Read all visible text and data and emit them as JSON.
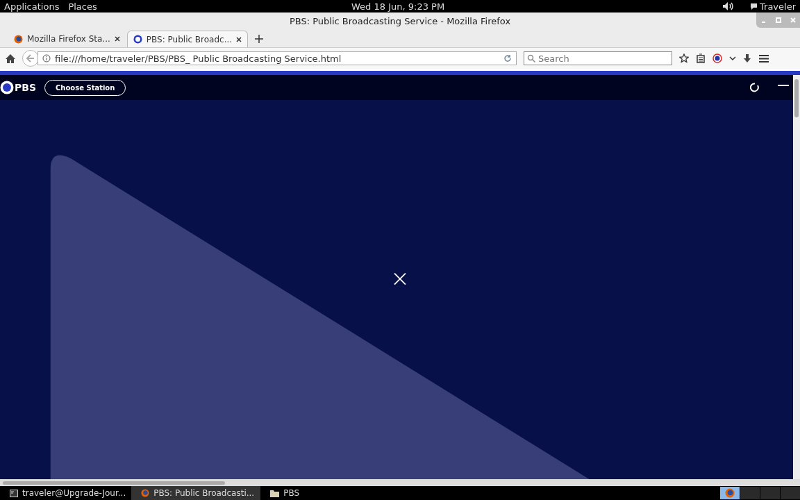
{
  "top_bar": {
    "menus": [
      "Applications",
      "Places"
    ],
    "clock": "Wed 18 Jun,  9:23 PM",
    "user": "Traveler"
  },
  "window": {
    "title": "PBS: Public Broadcasting Service - Mozilla Firefox"
  },
  "tabs": [
    {
      "label": "Mozilla Firefox Sta...",
      "selected": false,
      "kind": "firefox"
    },
    {
      "label": "PBS: Public Broadc...",
      "selected": true,
      "kind": "pbs"
    }
  ],
  "nav": {
    "url": "file:///home/traveler/PBS/PBS_ Public Broadcasting Service.html",
    "search": {
      "placeholder": "Search"
    }
  },
  "page": {
    "logo": "PBS",
    "choose_station": "Choose Station"
  },
  "taskbar": [
    {
      "label": "traveler@Upgrade-Jour...",
      "selected": false,
      "kind": "terminal"
    },
    {
      "label": "PBS: Public Broadcasti...",
      "selected": true,
      "kind": "firefox"
    },
    {
      "label": "PBS",
      "selected": false,
      "kind": "folder"
    }
  ]
}
